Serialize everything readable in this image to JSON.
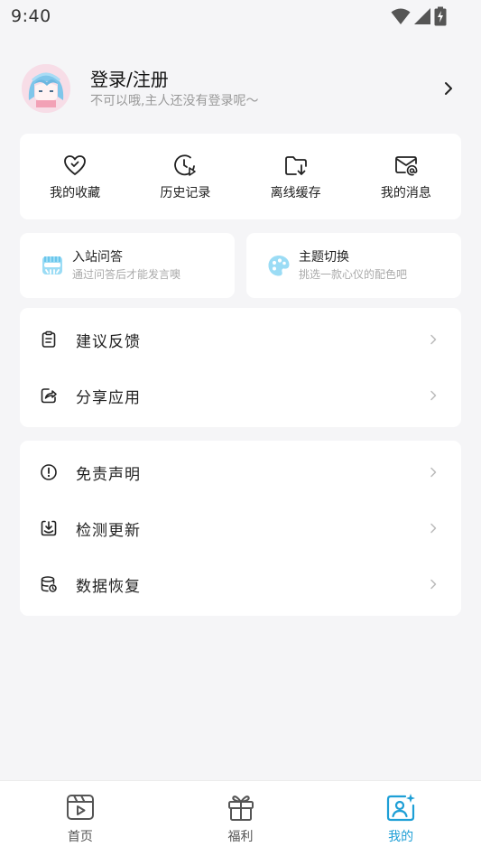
{
  "status_bar": {
    "time": "9:40",
    "icons": [
      "wifi-icon",
      "signal-icon",
      "battery-charging-icon"
    ]
  },
  "profile": {
    "title": "登录/注册",
    "subtitle": "不可以哦,主人还没有登录呢～",
    "avatar_icon": "anime-avatar"
  },
  "quick_actions": [
    {
      "label": "我的收藏",
      "icon": "heart-check-icon"
    },
    {
      "label": "历史记录",
      "icon": "clock-play-icon"
    },
    {
      "label": "离线缓存",
      "icon": "folder-download-icon"
    },
    {
      "label": "我的消息",
      "icon": "mail-at-icon"
    }
  ],
  "feature_cards": [
    {
      "title": "入站问答",
      "subtitle": "通过问答后才能发言噢",
      "icon": "quiz-icon"
    },
    {
      "title": "主题切换",
      "subtitle": "挑选一款心仪的配色吧",
      "icon": "palette-icon"
    }
  ],
  "menu_group_1": [
    {
      "label": "建议反馈",
      "icon": "clipboard-icon"
    },
    {
      "label": "分享应用",
      "icon": "share-icon"
    }
  ],
  "menu_group_2": [
    {
      "label": "免责声明",
      "icon": "info-circle-icon"
    },
    {
      "label": "检测更新",
      "icon": "update-download-icon"
    },
    {
      "label": "数据恢复",
      "icon": "database-icon"
    }
  ],
  "tab_bar": [
    {
      "label": "首页",
      "icon": "video-icon"
    },
    {
      "label": "福利",
      "icon": "gift-icon"
    },
    {
      "label": "我的",
      "icon": "profile-sparkle-icon"
    }
  ],
  "colors": {
    "accent": "#1e9fd6",
    "background": "#f5f5f7",
    "card": "#ffffff",
    "feature_icon": "#7fd3f2"
  }
}
